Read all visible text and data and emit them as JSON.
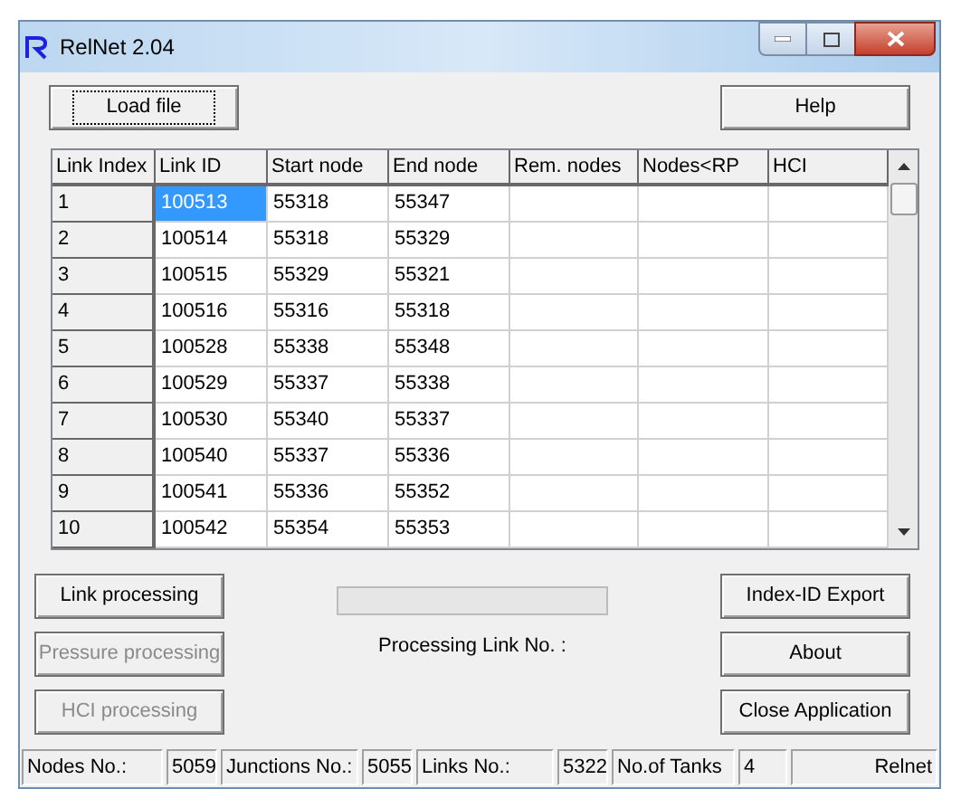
{
  "window": {
    "title": "RelNet 2.04"
  },
  "top_buttons": [
    {
      "label": "Load file",
      "focused": true
    },
    {
      "label": "Help",
      "focused": false
    }
  ],
  "table": {
    "columns": [
      "Link Index",
      "Link ID",
      "Start node",
      "End node",
      "Rem. nodes",
      "Nodes<RP",
      "HCI"
    ],
    "rows": [
      {
        "cells": [
          "1",
          "100513",
          "55318",
          "55347",
          "",
          "",
          ""
        ],
        "selected": true
      },
      {
        "cells": [
          "2",
          "100514",
          "55318",
          "55329",
          "",
          "",
          ""
        ],
        "selected": false
      },
      {
        "cells": [
          "3",
          "100515",
          "55329",
          "55321",
          "",
          "",
          ""
        ],
        "selected": false
      },
      {
        "cells": [
          "4",
          "100516",
          "55316",
          "55318",
          "",
          "",
          ""
        ],
        "selected": false
      },
      {
        "cells": [
          "5",
          "100528",
          "55338",
          "55348",
          "",
          "",
          ""
        ],
        "selected": false
      },
      {
        "cells": [
          "6",
          "100529",
          "55337",
          "55338",
          "",
          "",
          ""
        ],
        "selected": false
      },
      {
        "cells": [
          "7",
          "100530",
          "55340",
          "55337",
          "",
          "",
          ""
        ],
        "selected": false
      },
      {
        "cells": [
          "8",
          "100540",
          "55337",
          "55336",
          "",
          "",
          ""
        ],
        "selected": false
      },
      {
        "cells": [
          "9",
          "100541",
          "55336",
          "55352",
          "",
          "",
          ""
        ],
        "selected": false
      },
      {
        "cells": [
          "10",
          "100542",
          "55354",
          "55353",
          "",
          "",
          ""
        ],
        "selected": false
      }
    ]
  },
  "left_buttons": [
    {
      "label": "Link processing",
      "disabled": false
    },
    {
      "label": "Pressure processing",
      "disabled": true
    },
    {
      "label": "HCI processing",
      "disabled": true
    }
  ],
  "progress": {
    "label": "Processing Link No. :"
  },
  "right_buttons": [
    {
      "label": "Index-ID Export",
      "disabled": false
    },
    {
      "label": "About",
      "disabled": false
    },
    {
      "label": "Close Application",
      "disabled": false
    }
  ],
  "status_bar": [
    {
      "text": "Nodes No.:",
      "kind": "label"
    },
    {
      "text": "5059",
      "kind": "value"
    },
    {
      "text": "Junctions No.:",
      "kind": "label"
    },
    {
      "text": "5055",
      "kind": "value"
    },
    {
      "text": "Links No.:",
      "kind": "label"
    },
    {
      "text": "5322",
      "kind": "value"
    },
    {
      "text": "No.of Tanks",
      "kind": "label"
    },
    {
      "text": "4",
      "kind": "value"
    },
    {
      "text": "Relnet",
      "kind": "brand"
    }
  ]
}
